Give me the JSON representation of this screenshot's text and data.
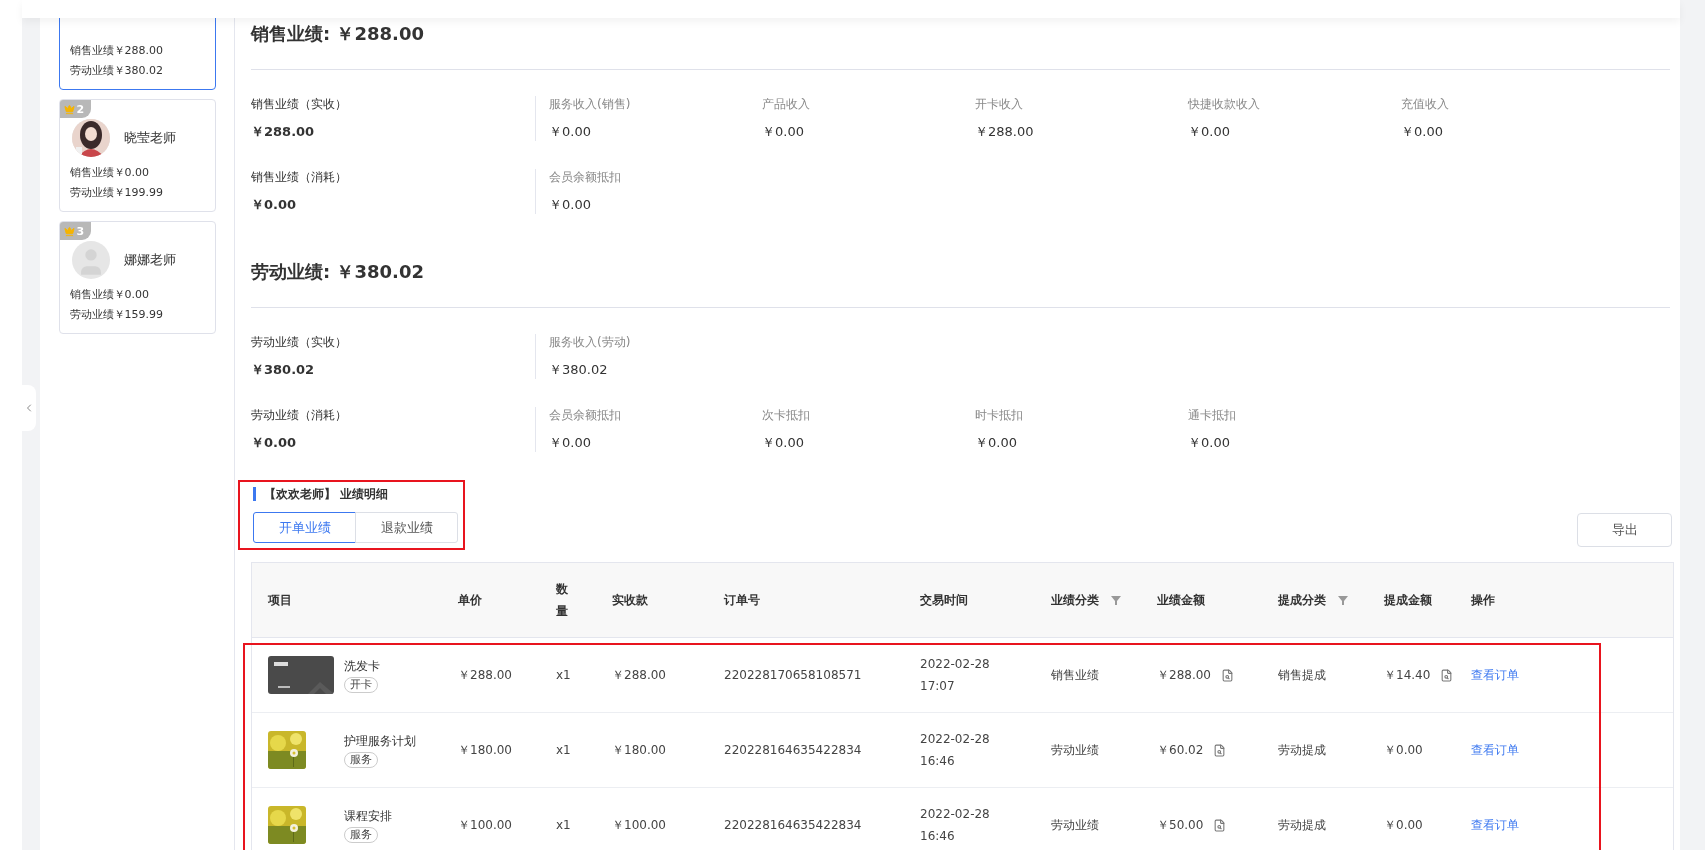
{
  "staff_cards": [
    {
      "kind": "partial",
      "selected": true,
      "sales": "销售业绩￥288.00",
      "labor": "劳动业绩￥380.02"
    },
    {
      "kind": "full",
      "selected": false,
      "rank": "2",
      "name": "晓莹老师",
      "sales": "销售业绩￥0.00",
      "labor": "劳动业绩￥199.99"
    },
    {
      "kind": "full",
      "selected": false,
      "rank": "3",
      "name": "娜娜老师",
      "sales": "销售业绩￥0.00",
      "labor": "劳动业绩￥159.99"
    }
  ],
  "sections": [
    {
      "title": "销售业绩: ￥288.00",
      "rows": [
        {
          "main": {
            "label": "销售业绩（实收）",
            "value": "￥288.00"
          },
          "items": [
            {
              "label": "服务收入(销售)",
              "value": "￥0.00"
            },
            {
              "label": "产品收入",
              "value": "￥0.00"
            },
            {
              "label": "开卡收入",
              "value": "￥288.00"
            },
            {
              "label": "快捷收款收入",
              "value": "￥0.00"
            },
            {
              "label": "充值收入",
              "value": "￥0.00"
            }
          ]
        },
        {
          "main": {
            "label": "销售业绩（消耗）",
            "value": "￥0.00"
          },
          "items": [
            {
              "label": "会员余额抵扣",
              "value": "￥0.00"
            }
          ]
        }
      ]
    },
    {
      "title": "劳动业绩: ￥380.02",
      "rows": [
        {
          "main": {
            "label": "劳动业绩（实收）",
            "value": "￥380.02"
          },
          "items": [
            {
              "label": "服务收入(劳动)",
              "value": "￥380.02"
            }
          ]
        },
        {
          "main": {
            "label": "劳动业绩（消耗）",
            "value": "￥0.00"
          },
          "items": [
            {
              "label": "会员余额抵扣",
              "value": "￥0.00"
            },
            {
              "label": "次卡抵扣",
              "value": "￥0.00"
            },
            {
              "label": "时卡抵扣",
              "value": "￥0.00"
            },
            {
              "label": "通卡抵扣",
              "value": "￥0.00"
            }
          ]
        }
      ]
    }
  ],
  "detail": {
    "title": "【欢欢老师】 业绩明细",
    "highlighted": true,
    "tabs": [
      {
        "label": "开单业绩",
        "selected": true
      },
      {
        "label": "退款业绩",
        "selected": false
      }
    ],
    "export_button": "导出"
  },
  "table": {
    "columns": [
      {
        "label": "项目",
        "filter": false
      },
      {
        "label": "单价",
        "filter": false
      },
      {
        "label": "数量",
        "filter": false
      },
      {
        "label": "实收款",
        "filter": false
      },
      {
        "label": "订单号",
        "filter": false
      },
      {
        "label": "交易时间",
        "filter": false
      },
      {
        "label": "业绩分类",
        "filter": true
      },
      {
        "label": "业绩金额",
        "filter": false
      },
      {
        "label": "提成分类",
        "filter": true
      },
      {
        "label": "提成金额",
        "filter": false
      },
      {
        "label": "操作",
        "filter": false
      }
    ],
    "rows_highlighted": true,
    "rows": [
      {
        "name": "洗发卡",
        "tag": "开卡",
        "price": "￥288.00",
        "qty": "x1",
        "received": "￥288.00",
        "order": "220228170658108571",
        "date": "2022-02-28",
        "time": "17:07",
        "category": "销售业绩",
        "amount": "￥288.00",
        "commission_category": "销售提成",
        "commission": "￥14.40",
        "commission_detail": true,
        "action": "查看订单"
      },
      {
        "name": "护理服务计划",
        "tag": "服务",
        "price": "￥180.00",
        "qty": "x1",
        "received": "￥180.00",
        "order": "220228164635422834",
        "date": "2022-02-28",
        "time": "16:46",
        "category": "劳动业绩",
        "amount": "￥60.02",
        "commission_category": "劳动提成",
        "commission": "￥0.00",
        "commission_detail": false,
        "action": "查看订单"
      },
      {
        "name": "课程安排",
        "tag": "服务",
        "price": "￥100.00",
        "qty": "x1",
        "received": "￥100.00",
        "order": "220228164635422834",
        "date": "2022-02-28",
        "time": "16:46",
        "category": "劳动业绩",
        "amount": "￥50.00",
        "commission_category": "劳动提成",
        "commission": "￥0.00",
        "commission_detail": false,
        "action": "查看订单"
      }
    ]
  }
}
